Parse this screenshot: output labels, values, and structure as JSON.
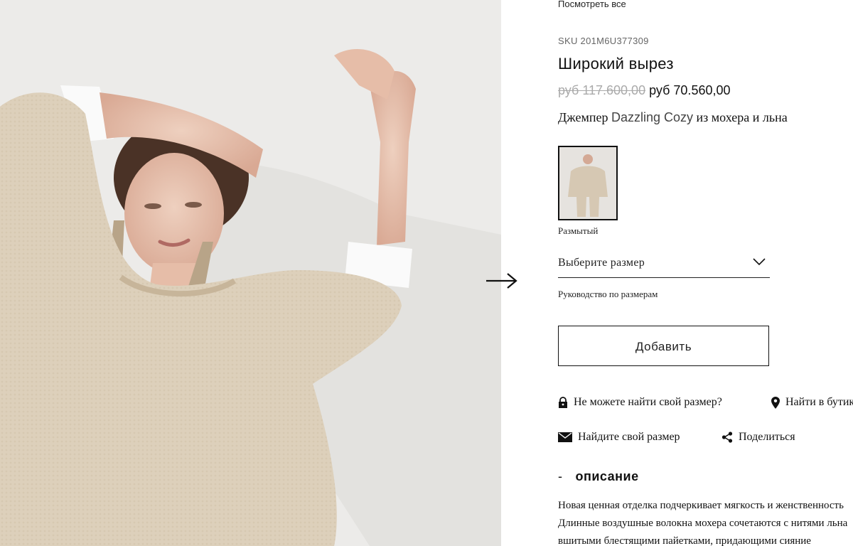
{
  "info": {
    "view_all": "Посмотреть все",
    "sku": "SKU 201M6U377309",
    "title": "Широкий вырез",
    "old_price": "руб 117.600,00",
    "new_price": "руб 70.560,00",
    "subtitle_prefix": "Джемпер ",
    "subtitle_brand": "Dazzling Cozy",
    "subtitle_suffix": " из мохера и льна",
    "color_label": "Размытый",
    "size_select_label": "Выберите размер",
    "size_guide": "Руководство по размерам",
    "add_button": "Добавить",
    "links": {
      "cant_find_size": "Не можете найти свой размер?",
      "find_in_boutique": "Найти в бутике",
      "find_your_size": "Найдите свой размер",
      "share": "Поделиться"
    },
    "description_dash": "-",
    "description_heading": "описание",
    "description_lines": [
      "Новая ценная отделка подчеркивает мягкость и женственность",
      "Длинные воздушные волокна мохера сочетаются с нитями льна",
      "вшитыми блестящими пайетками, придающими сияние"
    ]
  },
  "icons": {
    "next": "arrow-right-icon",
    "chevron": "chevron-down-icon",
    "lock": "lock-icon",
    "pin": "map-pin-icon",
    "mail": "mail-icon",
    "share": "share-icon"
  },
  "colors": {
    "text": "#111111",
    "muted": "#aaaaaa",
    "photo_bg": "#ecebe9",
    "sweater": "#d9cbb5"
  }
}
